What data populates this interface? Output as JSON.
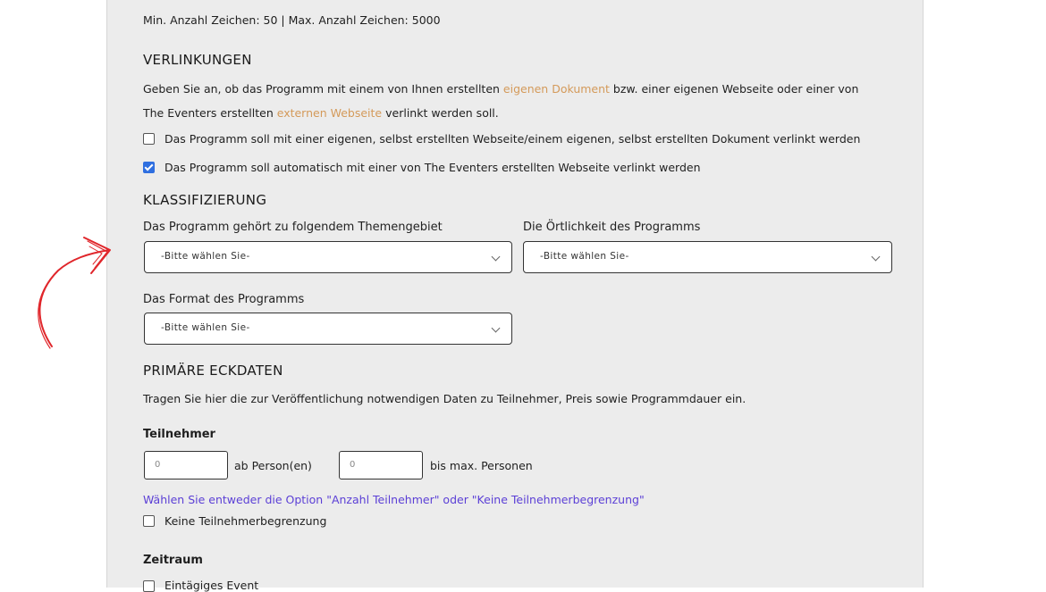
{
  "form": {
    "char_limit": "Min. Anzahl Zeichen: 50 | Max. Anzahl Zeichen: 5000",
    "verlinkungen": {
      "heading": "VERLINKUNGEN",
      "desc_part1": "Geben Sie an, ob das Programm mit einem von Ihnen erstellten ",
      "link1": "eigenen Dokument",
      "desc_part2": " bzw. einer eigenen Webseite oder einer von",
      "desc_part3": "The Eventers erstellten ",
      "link2": "externen Webseite",
      "desc_part4": " verlinkt werden soll.",
      "option1": "Das Programm soll mit einer eigenen, selbst erstellten Webseite/einem eigenen, selbst erstellten Dokument verlinkt werden",
      "option1_checked": false,
      "option2": "Das Programm soll automatisch mit einer von The Eventers erstellten Webseite verlinkt werden",
      "option2_checked": true
    },
    "klassifizierung": {
      "heading": "KLASSIFIZIERUNG",
      "themengebiet_label": "Das Programm gehört zu folgendem Themengebiet",
      "themengebiet_value": "-Bitte wählen Sie-",
      "oertlichkeit_label": "Die Örtlichkeit des Programms",
      "oertlichkeit_value": "-Bitte wählen Sie-",
      "format_label": "Das Format des Programms",
      "format_value": "-Bitte wählen Sie-"
    },
    "eckdaten": {
      "heading": "PRIMÄRE ECKDATEN",
      "desc": "Tragen Sie hier die zur Veröffentlichung notwendigen Daten zu Teilnehmer, Preis sowie Programmdauer ein.",
      "teilnehmer_heading": "Teilnehmer",
      "min_placeholder": "0",
      "min_suffix": "ab Person(en)",
      "max_placeholder": "0",
      "max_suffix": "bis max. Personen",
      "hint": "Wählen Sie entweder die Option \"Anzahl Teilnehmer\" oder \"Keine Teilnehmerbegrenzung\"",
      "no_limit": "Keine Teilnehmerbegrenzung",
      "zeitraum_heading": "Zeitraum",
      "eintaegig": "Eintägiges Event"
    }
  },
  "annotation": {
    "arrow_color": "#e0262b"
  }
}
